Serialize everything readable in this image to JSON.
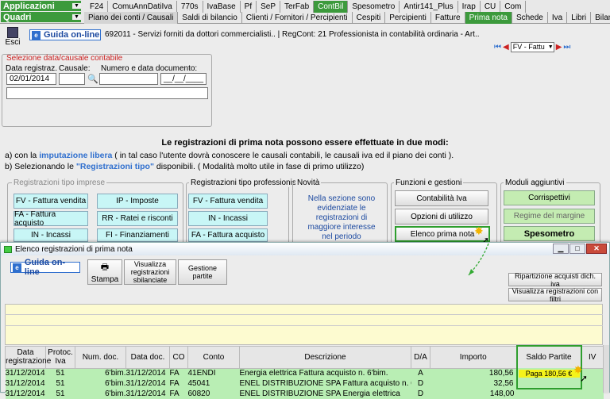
{
  "topbar": {
    "app_select": "Applicazioni",
    "quadri_select": "Quadri",
    "row1": [
      "F24",
      "ComuAnnDatiIva",
      "770s",
      "IvaBase",
      "Pf",
      "SeP",
      "TerFab",
      "ContBil",
      "Spesometro",
      "Antir141_Plus",
      "Irap",
      "CU",
      "Com"
    ],
    "row2": [
      "Piano dei conti / Causali",
      "Saldi di bilancio",
      "Clienti / Fornitori / Percipienti",
      "Cespiti",
      "Percipienti",
      "Fatture",
      "Prima nota",
      "Schede",
      "Iva",
      "Libri",
      "Bilancio"
    ]
  },
  "toolbar": {
    "exit_label": "Esci",
    "guide_label": "Guida on-line",
    "info_text": "692011 - Servizi forniti da dottori commercialisti.. | RegCont: 21 Professionista in contabilità ordinaria - Art..",
    "nav_select": "FV - Fattu"
  },
  "selection": {
    "legend": "Selezione data/causale contabile",
    "date_label": "Data registraz.",
    "causal_label": "Causale:",
    "doc_label": "Numero e data documento:",
    "date_value": "02/01/2014",
    "doc_date_placeholder": "__/__/____"
  },
  "intro": {
    "title": "Le registrazioni di prima nota possono essere effettuate in due modi:",
    "line_a_pre": "a) con la ",
    "line_a_link": "imputazione libera",
    "line_a_post": " ( in tal caso l'utente dovrà conoscere le causali contabili, le causali iva ed il piano dei conti ).",
    "line_b_pre": "b) Selezionando le ",
    "line_b_link": "\"Registrazioni tipo\"",
    "line_b_post": " disponibili. ( Modalità molto utile in fase di primo utilizzo)"
  },
  "panels": {
    "imprese_legend": "Registrazioni tipo imprese",
    "imprese": [
      "FV - Fattura vendita",
      "IP - Imposte",
      "FA - Fattura acquisto",
      "RR - Ratei e risconti",
      "IN - Incassi",
      "FI - Finanziamenti"
    ],
    "prof_legend": "Registrazioni tipo professionisti",
    "prof": [
      "FV - Fattura vendita",
      "IN - Incassi",
      "FA - Fattura acquisto"
    ],
    "novita_legend": "Novità",
    "novita_text": "Nella sezione sono evidenziate le registrazioni di maggiore interesse nel periodo",
    "funzioni_legend": "Funzioni e gestioni",
    "funzioni": [
      "Contabilità Iva",
      "Opzioni di utilizzo",
      "Elenco prima nota"
    ],
    "moduli_legend": "Moduli aggiuntivi",
    "moduli": [
      "Corrispettivi",
      "Regime del margine",
      "Spesometro"
    ]
  },
  "dialog": {
    "title": "Elenco registrazioni di prima nota",
    "guide_label": "Guida on-line",
    "print_label": "Stampa",
    "unbalanced_label": "Visualizza registrazioni sbilanciate",
    "partite_label": "Gestione partite",
    "ripartizione_label": "Ripartizione acquisti dich. iva",
    "filtri_label": "Visualizza registrazioni con filtri",
    "columns": [
      "Data registrazione",
      "Protoc. Iva",
      "Num. doc.",
      "Data doc.",
      "CO",
      "Conto",
      "Descrizione",
      "D/A",
      "Importo",
      "Saldo Partite",
      "IV"
    ],
    "rows": [
      [
        "31/12/2014",
        "51",
        "6'bim.",
        "31/12/2014",
        "FA",
        "41ENDI",
        "Energia elettrica Fattura acquisto n. 6'bim.",
        "A",
        "180,56",
        "Paga 180,56 €",
        ""
      ],
      [
        "31/12/2014",
        "51",
        "6'bim.",
        "31/12/2014",
        "FA",
        "45041",
        "ENEL DISTRIBUZIONE SPA Fattura acquisto n. 6'bim",
        "D",
        "32,56",
        "",
        ""
      ],
      [
        "31/12/2014",
        "51",
        "6'bim.",
        "31/12/2014",
        "FA",
        "60820",
        "ENEL DISTRIBUZIONE SPA Energia elettrica",
        "D",
        "148,00",
        "",
        ""
      ]
    ]
  },
  "colors": {
    "accent_blue": "#2f6fce",
    "highlight_green": "#2e9e2e",
    "saldo_yellow": "#f5f31a",
    "row_green": "#b9eeb4"
  }
}
